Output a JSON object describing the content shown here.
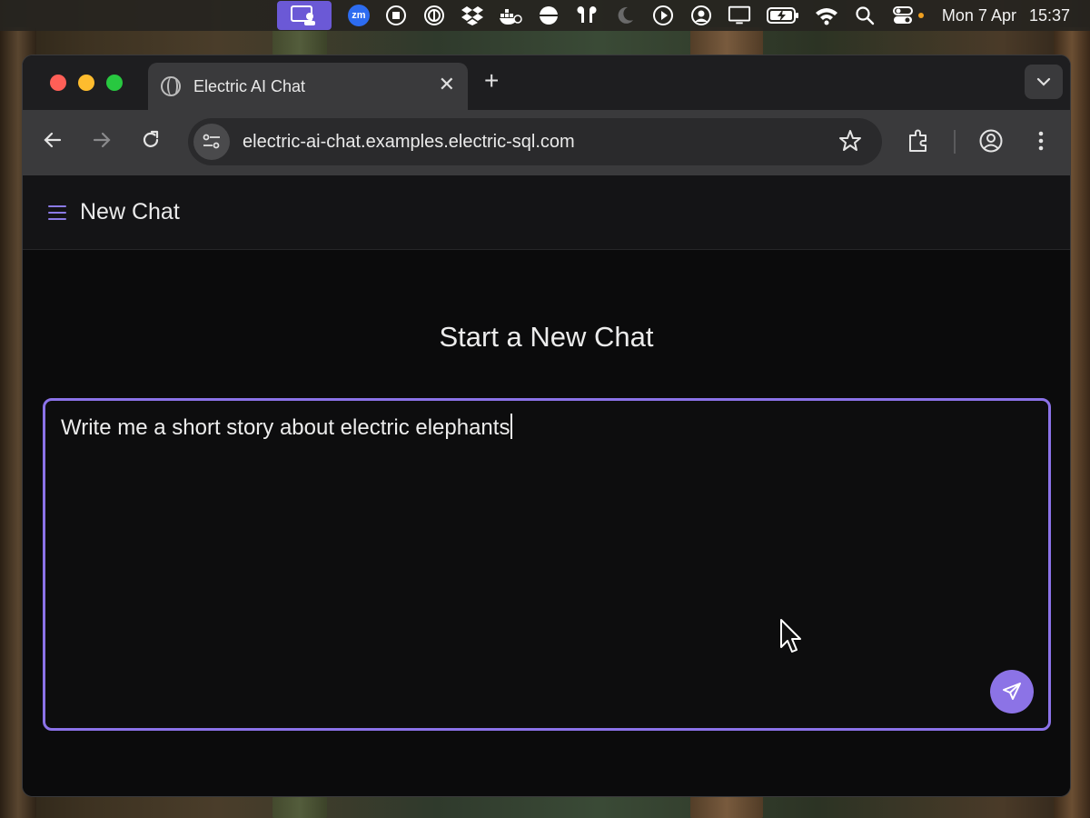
{
  "menubar": {
    "zoom_label": "zm",
    "date": "Mon 7 Apr",
    "time": "15:37"
  },
  "browser": {
    "tab_title": "Electric AI Chat",
    "url": "electric-ai-chat.examples.electric-sql.com"
  },
  "app": {
    "header_title": "New Chat",
    "page_title": "Start a New Chat",
    "composer_text": "Write me a short story about electric elephants"
  },
  "colors": {
    "accent": "#8b72e8",
    "window_bg": "#0b0b0c",
    "header_bg": "#141416"
  }
}
